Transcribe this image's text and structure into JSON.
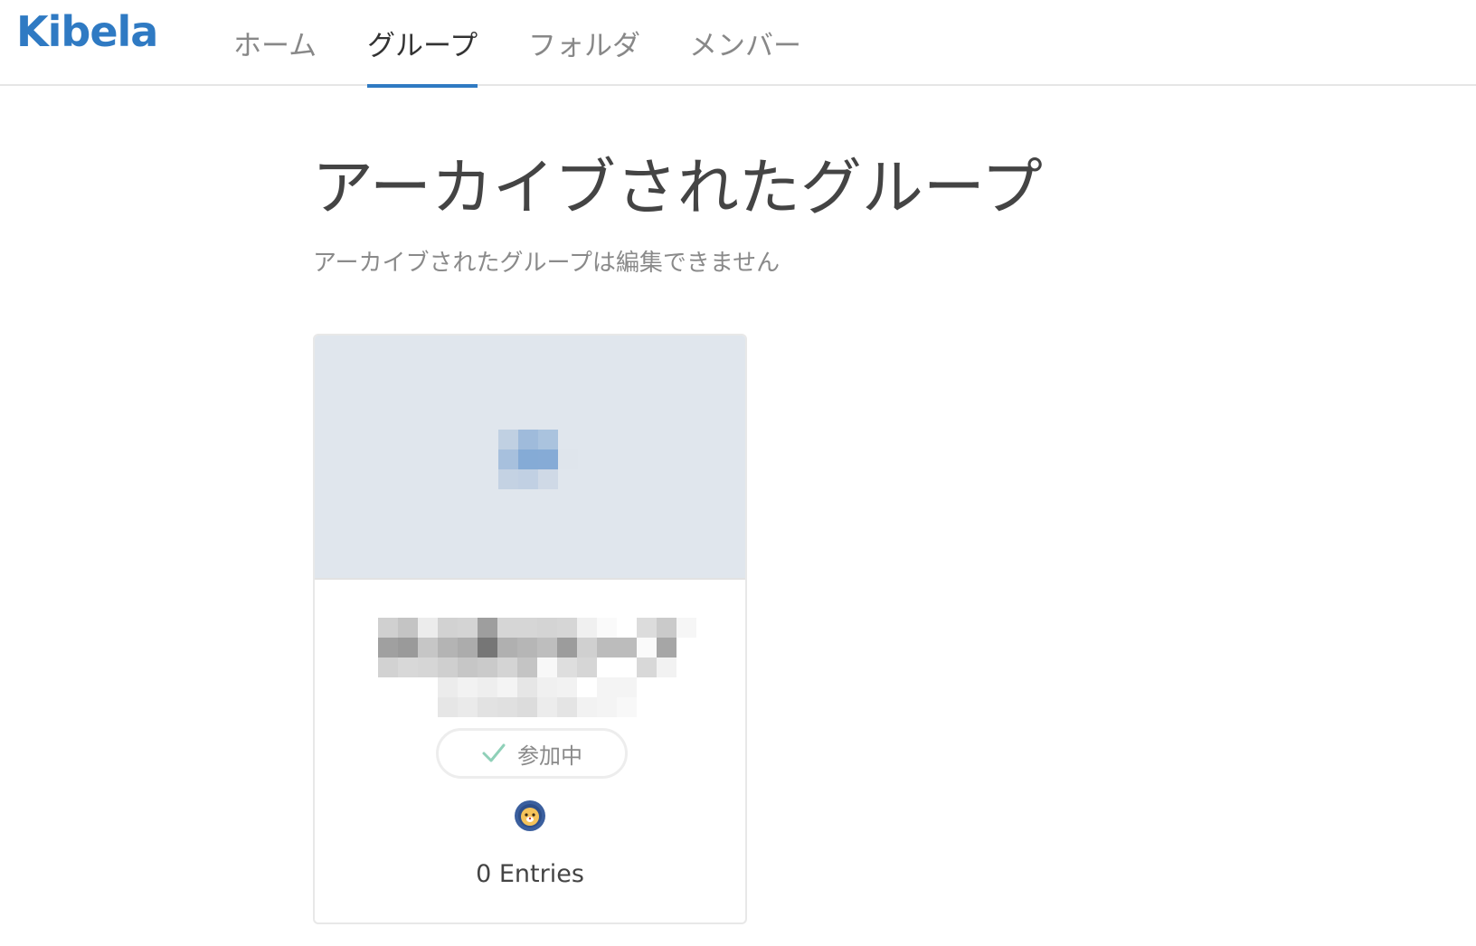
{
  "header": {
    "logo_text": "Kibela",
    "brand_color": "#2f7ac3",
    "nav": [
      {
        "label": "ホーム",
        "active": false
      },
      {
        "label": "グループ",
        "active": true
      },
      {
        "label": "フォルダ",
        "active": false
      },
      {
        "label": "メンバー",
        "active": false
      }
    ]
  },
  "main": {
    "title": "アーカイブされたグループ",
    "subtitle": "アーカイブされたグループは編集できません"
  },
  "group_card": {
    "join_label": "参加中",
    "join_icon": "check-icon",
    "avatar_icon": "lion-avatar-icon",
    "entries_label": "0 Entries",
    "banner_color": "#e0e6ed"
  }
}
